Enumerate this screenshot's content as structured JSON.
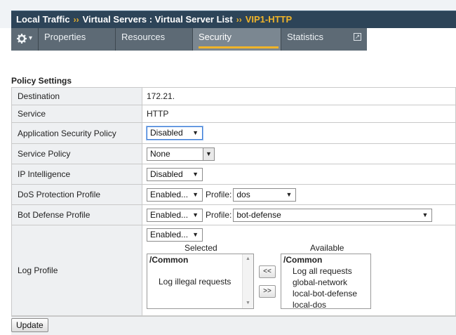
{
  "breadcrumb": {
    "part1": "Local Traffic",
    "sep": "››",
    "part2": "Virtual Servers : Virtual Server List",
    "current": "VIP1-HTTP"
  },
  "tabs": {
    "gear_icon": "gear-icon",
    "gear_caret": "▾",
    "properties": "Properties",
    "resources": "Resources",
    "security": "Security",
    "statistics": "Statistics",
    "external_icon": "↗"
  },
  "section_title": "Policy Settings",
  "rows": {
    "destination": {
      "label": "Destination",
      "value": "172.21."
    },
    "service": {
      "label": "Service",
      "value": "HTTP"
    },
    "app_security": {
      "label": "Application Security Policy",
      "selected": "Disabled"
    },
    "service_policy": {
      "label": "Service Policy",
      "selected": "None"
    },
    "ip_intel": {
      "label": "IP Intelligence",
      "selected": "Disabled"
    },
    "dos": {
      "label": "DoS Protection Profile",
      "selected": "Enabled...",
      "profile_label": "Profile:",
      "profile_selected": "dos"
    },
    "bot": {
      "label": "Bot Defense Profile",
      "selected": "Enabled...",
      "profile_label": "Profile:",
      "profile_selected": "bot-defense"
    },
    "log": {
      "label": "Log Profile",
      "selected": "Enabled...",
      "selected_heading": "Selected",
      "available_heading": "Available",
      "selected_group": "/Common",
      "selected_items": [
        "Log illegal requests"
      ],
      "available_group": "/Common",
      "available_items": [
        "Log all requests",
        "global-network",
        "local-bot-defense",
        "local-dos"
      ],
      "move_left": "<<",
      "move_right": ">>"
    }
  },
  "update_button": "Update",
  "colors": {
    "breadcrumb_bg": "#2d4458",
    "accent": "#f0b429",
    "tabbar_bg": "#5d6a75",
    "active_tab_bg": "#7b8791"
  }
}
